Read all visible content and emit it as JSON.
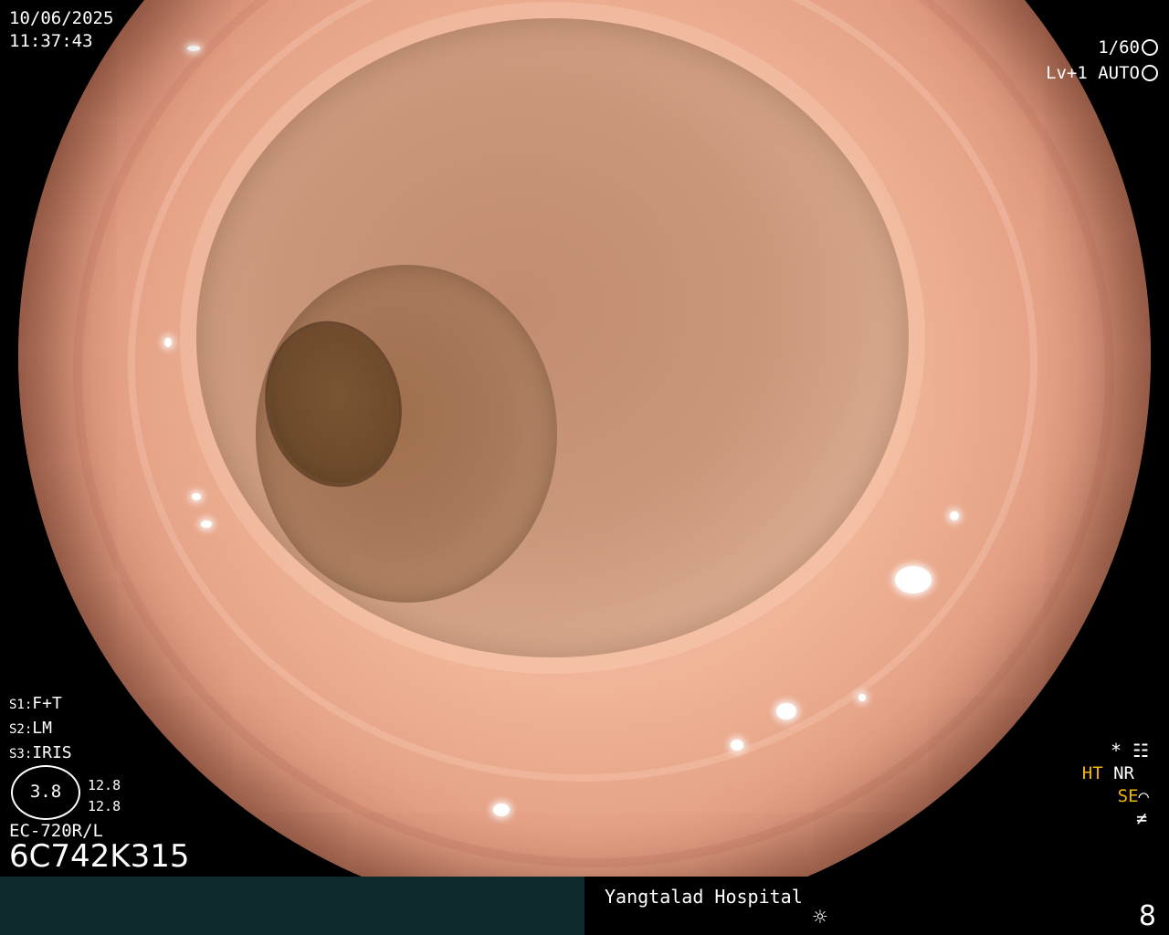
{
  "overlay": {
    "date": "10/06/2025",
    "time": "11:37:43",
    "shutter": "1/60",
    "level": "Lv+1",
    "mode": "AUTO",
    "settings": [
      {
        "key": "S1:",
        "value": "F+T"
      },
      {
        "key": "S2:",
        "value": "LM"
      },
      {
        "key": "S3:",
        "value": "IRIS"
      }
    ],
    "gauge_value": "3.8",
    "gauge_readout_1": "12.8",
    "gauge_readout_2": "12.8",
    "scope_model": "EC-720R/L",
    "scope_serial": "6C742K315",
    "right_star": "*",
    "ht_label": "HT",
    "nr_label": "NR",
    "se_label": "SE",
    "colors": {
      "accent_yellow": "#f5b800",
      "bar_bg": "#0f2a2a"
    }
  },
  "status_bar": {
    "hospital": "Yangtalad Hospital",
    "brightness_icon": "sun-icon",
    "page_number": "8"
  }
}
